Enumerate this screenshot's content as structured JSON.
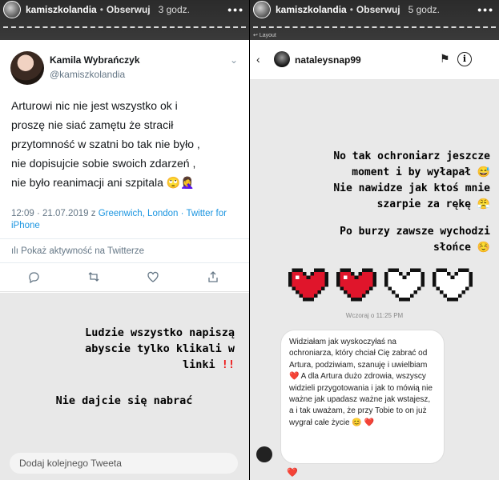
{
  "left_story": {
    "username": "kamiszkolandia",
    "follow_label": "Obserwuj",
    "time": "3 godz.",
    "more": "•••"
  },
  "tweet": {
    "name": "Kamila Wybrańczyk",
    "handle": "@kamiszkolandia",
    "chevron": "⌄",
    "body_lines": [
      "Arturowi nic nie jest wszystko ok i",
      "proszę nie siać zamętu że stracił",
      "przytomność w szatni bo tak nie było ,",
      "nie dopisujcie sobie swoich zdarzeń ,",
      "nie było reanimacji ani szpitala 🙄🤦‍♀️"
    ],
    "meta_prefix": "12:09 · 21.07.2019 z ",
    "meta_link": "Greenwich, London · Twitter for iPhone",
    "activity": "Pokaż aktywność na Twitterze",
    "icons": [
      "reply-icon",
      "retweet-icon",
      "like-icon",
      "share-icon"
    ]
  },
  "left_gray": {
    "msg1_lines": [
      "Ludzie wszystko napiszą",
      "abyscie tylko klikali w",
      "linki !!"
    ],
    "msg2": "Nie dajcie się nabrać",
    "input_placeholder": "Dodaj kolejnego Tweeta"
  },
  "right_story": {
    "username": "kamiszkolandia",
    "follow_label": "Obserwuj",
    "time": "5 godz.",
    "more": "•••",
    "layout_label": "Layout"
  },
  "ig": {
    "back": "‹",
    "user": "nataleysnap99",
    "flag": "⚑",
    "info": "i",
    "msg1_lines": [
      "No tak ochroniarz jeszcze",
      "moment i by wyłapał 😅",
      "Nie nawidze jak ktoś mnie",
      "szarpie za rękę 😤"
    ],
    "msg2_lines": [
      "Po burzy zawsze wychodzi",
      "słońce ☺️"
    ],
    "timestamp": "Wczoraj o 11:25 PM",
    "bubble_text": "Widziałam jak wyskoczyłaś na ochroniarza, który chciał Cię zabrać od Artura, podziwiam, szanuję i uwielbiam ❤️ A dla Artura dużo zdrowia, wszyscy widzieli przygotowania i jak to mówią nie ważne jak upadasz ważne jak wstajesz, a i tak uważam, że przy Tobie to on już wygrał całe życie 😊 ❤️",
    "reactions": "❤️"
  },
  "colors": {
    "twitter_blue": "#1b95e0",
    "heart_red": "#e0152b"
  }
}
